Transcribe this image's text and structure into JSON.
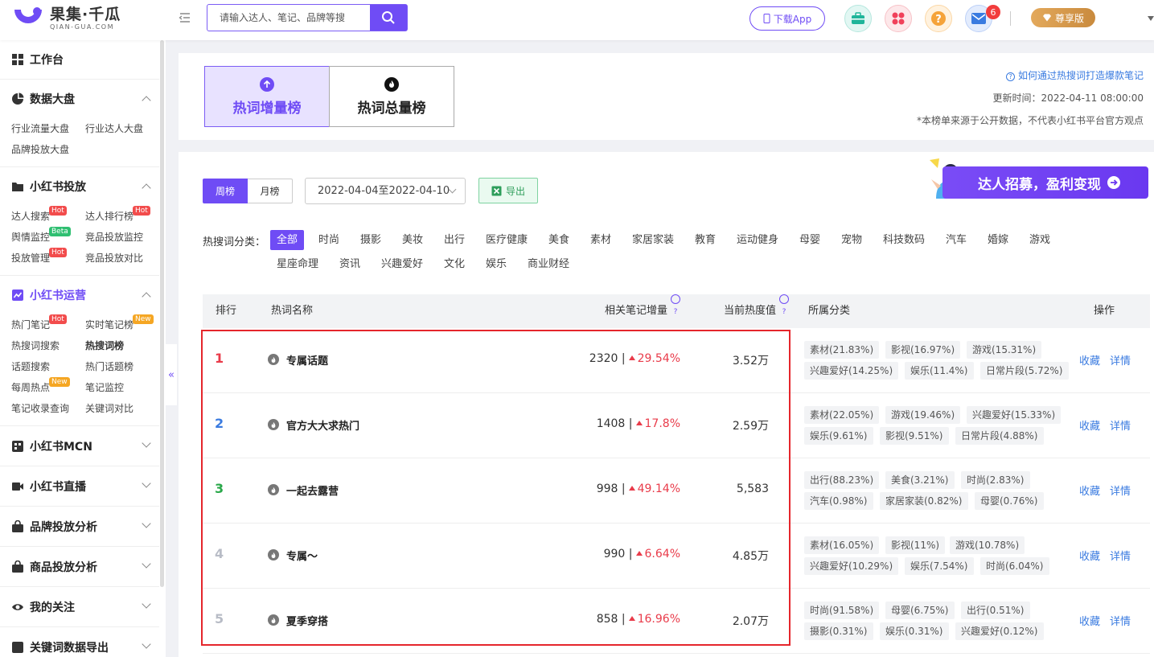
{
  "header": {
    "logo_cn": "果集·千瓜",
    "logo_en": "QIAN-GUA.COM",
    "search_placeholder": "请输入达人、笔记、品牌等搜",
    "download_label": "下载App",
    "mail_badge": "6",
    "vip_label": "尊享版"
  },
  "sidebar": {
    "workbench": "工作台",
    "sections": [
      {
        "title": "数据大盘",
        "items": [
          {
            "label": "行业流量大盘"
          },
          {
            "label": "行业达人大盘"
          },
          {
            "label": "品牌投放大盘"
          }
        ]
      },
      {
        "title": "小红书投放",
        "items": [
          {
            "label": "达人搜索",
            "tag": "Hot"
          },
          {
            "label": "达人排行榜",
            "tag": "Hot"
          },
          {
            "label": "舆情监控",
            "tag": "Beta"
          },
          {
            "label": "竞品投放监控"
          },
          {
            "label": "投放管理",
            "tag": "Hot"
          },
          {
            "label": "竞品投放对比"
          }
        ]
      },
      {
        "title": "小红书运营",
        "items": [
          {
            "label": "热门笔记",
            "tag": "Hot"
          },
          {
            "label": "实时笔记榜",
            "tag": "New"
          },
          {
            "label": "热搜词搜索"
          },
          {
            "label": "热搜词榜"
          },
          {
            "label": "话题搜索"
          },
          {
            "label": "热门话题榜"
          },
          {
            "label": "每周热点",
            "tag": "New"
          },
          {
            "label": "笔记监控"
          },
          {
            "label": "笔记收录查询"
          },
          {
            "label": "关键词对比"
          }
        ]
      }
    ],
    "collapsed": [
      "小红书MCN",
      "小红书直播",
      "品牌投放分析",
      "商品投放分析",
      "我的关注",
      "关键词数据导出"
    ],
    "collapse_arrow": "«"
  },
  "top_card": {
    "tabs": [
      "热词增量榜",
      "热词总量榜"
    ],
    "help_link": "如何通过热搜词打造爆款笔记",
    "update_time": "更新时间：2022-04-11 08:00:00",
    "disclaimer": "*本榜单来源于公开数据，不代表小红书平台官方观点"
  },
  "filters": {
    "period_week": "周榜",
    "period_month": "月榜",
    "date_range": "2022-04-04至2022-04-10",
    "export_label": "导出",
    "banner_text": "达人招募，盈利变现",
    "category_label": "热搜词分类：",
    "categories": [
      "全部",
      "时尚",
      "摄影",
      "美妆",
      "出行",
      "医疗健康",
      "美食",
      "素材",
      "家居家装",
      "教育",
      "运动健身",
      "母婴",
      "宠物",
      "科技数码",
      "汽车",
      "婚嫁",
      "游戏",
      "星座命理",
      "资讯",
      "兴趣爱好",
      "文化",
      "娱乐",
      "商业财经"
    ]
  },
  "table": {
    "headers": [
      "排行",
      "热词名称",
      "相关笔记增量",
      "当前热度值",
      "所属分类",
      "操作"
    ],
    "op_collect": "收藏",
    "op_detail": "详情",
    "rows": [
      {
        "rank": "1",
        "keyword": "专属话题",
        "count": "2320",
        "pct": "29.54%",
        "heat": "3.52万",
        "chips": [
          "素材(21.83%)",
          "影视(16.97%)",
          "游戏(15.31%)",
          "兴趣爱好(14.25%)",
          "娱乐(11.4%)",
          "日常片段(5.72%)"
        ]
      },
      {
        "rank": "2",
        "keyword": "官方大大求热门",
        "count": "1408",
        "pct": "17.8%",
        "heat": "2.59万",
        "chips": [
          "素材(22.05%)",
          "游戏(19.46%)",
          "兴趣爱好(15.33%)",
          "娱乐(9.61%)",
          "影视(9.51%)",
          "日常片段(4.88%)"
        ]
      },
      {
        "rank": "3",
        "keyword": "一起去露营",
        "count": "998",
        "pct": "49.14%",
        "heat": "5,583",
        "chips": [
          "出行(88.23%)",
          "美食(3.21%)",
          "时尚(2.83%)",
          "汽车(0.98%)",
          "家居家装(0.82%)",
          "母婴(0.76%)"
        ]
      },
      {
        "rank": "4",
        "keyword": "专属～",
        "count": "990",
        "pct": "6.64%",
        "heat": "4.85万",
        "chips": [
          "素材(16.05%)",
          "影视(11%)",
          "游戏(10.78%)",
          "兴趣爱好(10.29%)",
          "娱乐(7.54%)",
          "时尚(6.04%)"
        ]
      },
      {
        "rank": "5",
        "keyword": "夏季穿搭",
        "count": "858",
        "pct": "16.96%",
        "heat": "2.07万",
        "chips": [
          "时尚(91.58%)",
          "母婴(6.75%)",
          "出行(0.51%)",
          "摄影(0.31%)",
          "娱乐(0.31%)",
          "兴趣爱好(0.12%)"
        ]
      }
    ]
  },
  "colors": {
    "accent": "#6f4cf5",
    "rank1": "#e93b4a",
    "rank2": "#3a7be0",
    "rank3": "#2aa84a",
    "rank_other": "#b8bcc6",
    "up": "#e93b4a",
    "link": "#3a7be0"
  }
}
